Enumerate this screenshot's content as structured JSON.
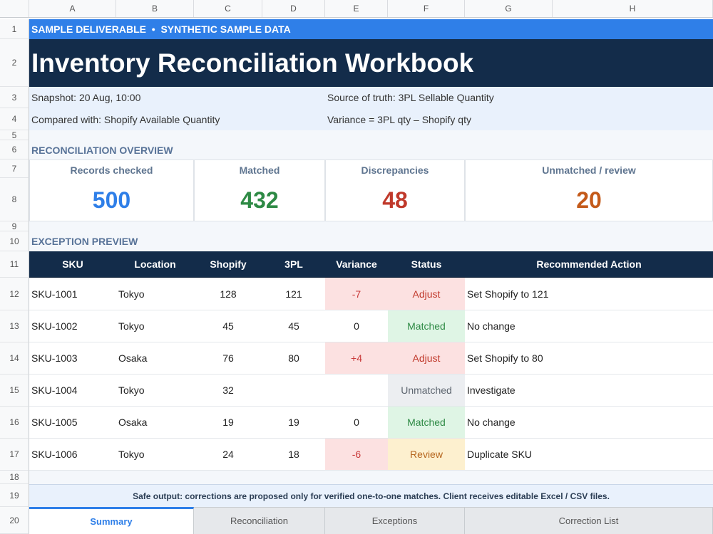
{
  "columns": [
    "A",
    "B",
    "C",
    "D",
    "E",
    "F",
    "G",
    "H"
  ],
  "rows": [
    "1",
    "2",
    "3",
    "4",
    "5",
    "6",
    "7",
    "8",
    "9",
    "10",
    "11",
    "12",
    "13",
    "14",
    "15",
    "16",
    "17",
    "18",
    "19",
    "20"
  ],
  "banner": "SAMPLE DELIVERABLE  •  SYNTHETIC SAMPLE DATA",
  "title": "Inventory Reconciliation Workbook",
  "meta": {
    "snapshot": "Snapshot: 20 Aug, 10:00",
    "source": "Source of truth: 3PL Sellable Quantity",
    "compared": "Compared with: Shopify Available Quantity",
    "variance": "Variance = 3PL qty – Shopify qty"
  },
  "overview_label": "RECONCILIATION OVERVIEW",
  "kpis": [
    {
      "label": "Records checked",
      "value": "500",
      "color": "#2f7fe8"
    },
    {
      "label": "Matched",
      "value": "432",
      "color": "#2e8a45"
    },
    {
      "label": "Discrepancies",
      "value": "48",
      "color": "#c0392b"
    },
    {
      "label": "Unmatched / review",
      "value": "20",
      "color": "#c45a1a"
    }
  ],
  "exceptions_label": "EXCEPTION PREVIEW",
  "table": {
    "headers": [
      "SKU",
      "Location",
      "Shopify",
      "3PL",
      "Variance",
      "Status",
      "Recommended Action"
    ],
    "rows": [
      {
        "sku": "SKU-1001",
        "location": "Tokyo",
        "shopify": "128",
        "tpl": "121",
        "variance": "-7",
        "status": "Adjust",
        "action": "Set Shopify to 121"
      },
      {
        "sku": "SKU-1002",
        "location": "Tokyo",
        "shopify": "45",
        "tpl": "45",
        "variance": "0",
        "status": "Matched",
        "action": "No change"
      },
      {
        "sku": "SKU-1003",
        "location": "Osaka",
        "shopify": "76",
        "tpl": "80",
        "variance": "+4",
        "status": "Adjust",
        "action": "Set Shopify to 80"
      },
      {
        "sku": "SKU-1004",
        "location": "Tokyo",
        "shopify": "32",
        "tpl": "",
        "variance": "",
        "status": "Unmatched",
        "action": "Investigate"
      },
      {
        "sku": "SKU-1005",
        "location": "Osaka",
        "shopify": "19",
        "tpl": "19",
        "variance": "0",
        "status": "Matched",
        "action": "No change"
      },
      {
        "sku": "SKU-1006",
        "location": "Tokyo",
        "shopify": "24",
        "tpl": "18",
        "variance": "-6",
        "status": "Review",
        "action": "Duplicate SKU"
      }
    ]
  },
  "footer_note": "Safe output: corrections are proposed only for verified one-to-one matches.  Client receives editable Excel / CSV files.",
  "tabs": [
    "Summary",
    "Reconciliation",
    "Exceptions",
    "Correction List"
  ],
  "active_tab": "Summary"
}
